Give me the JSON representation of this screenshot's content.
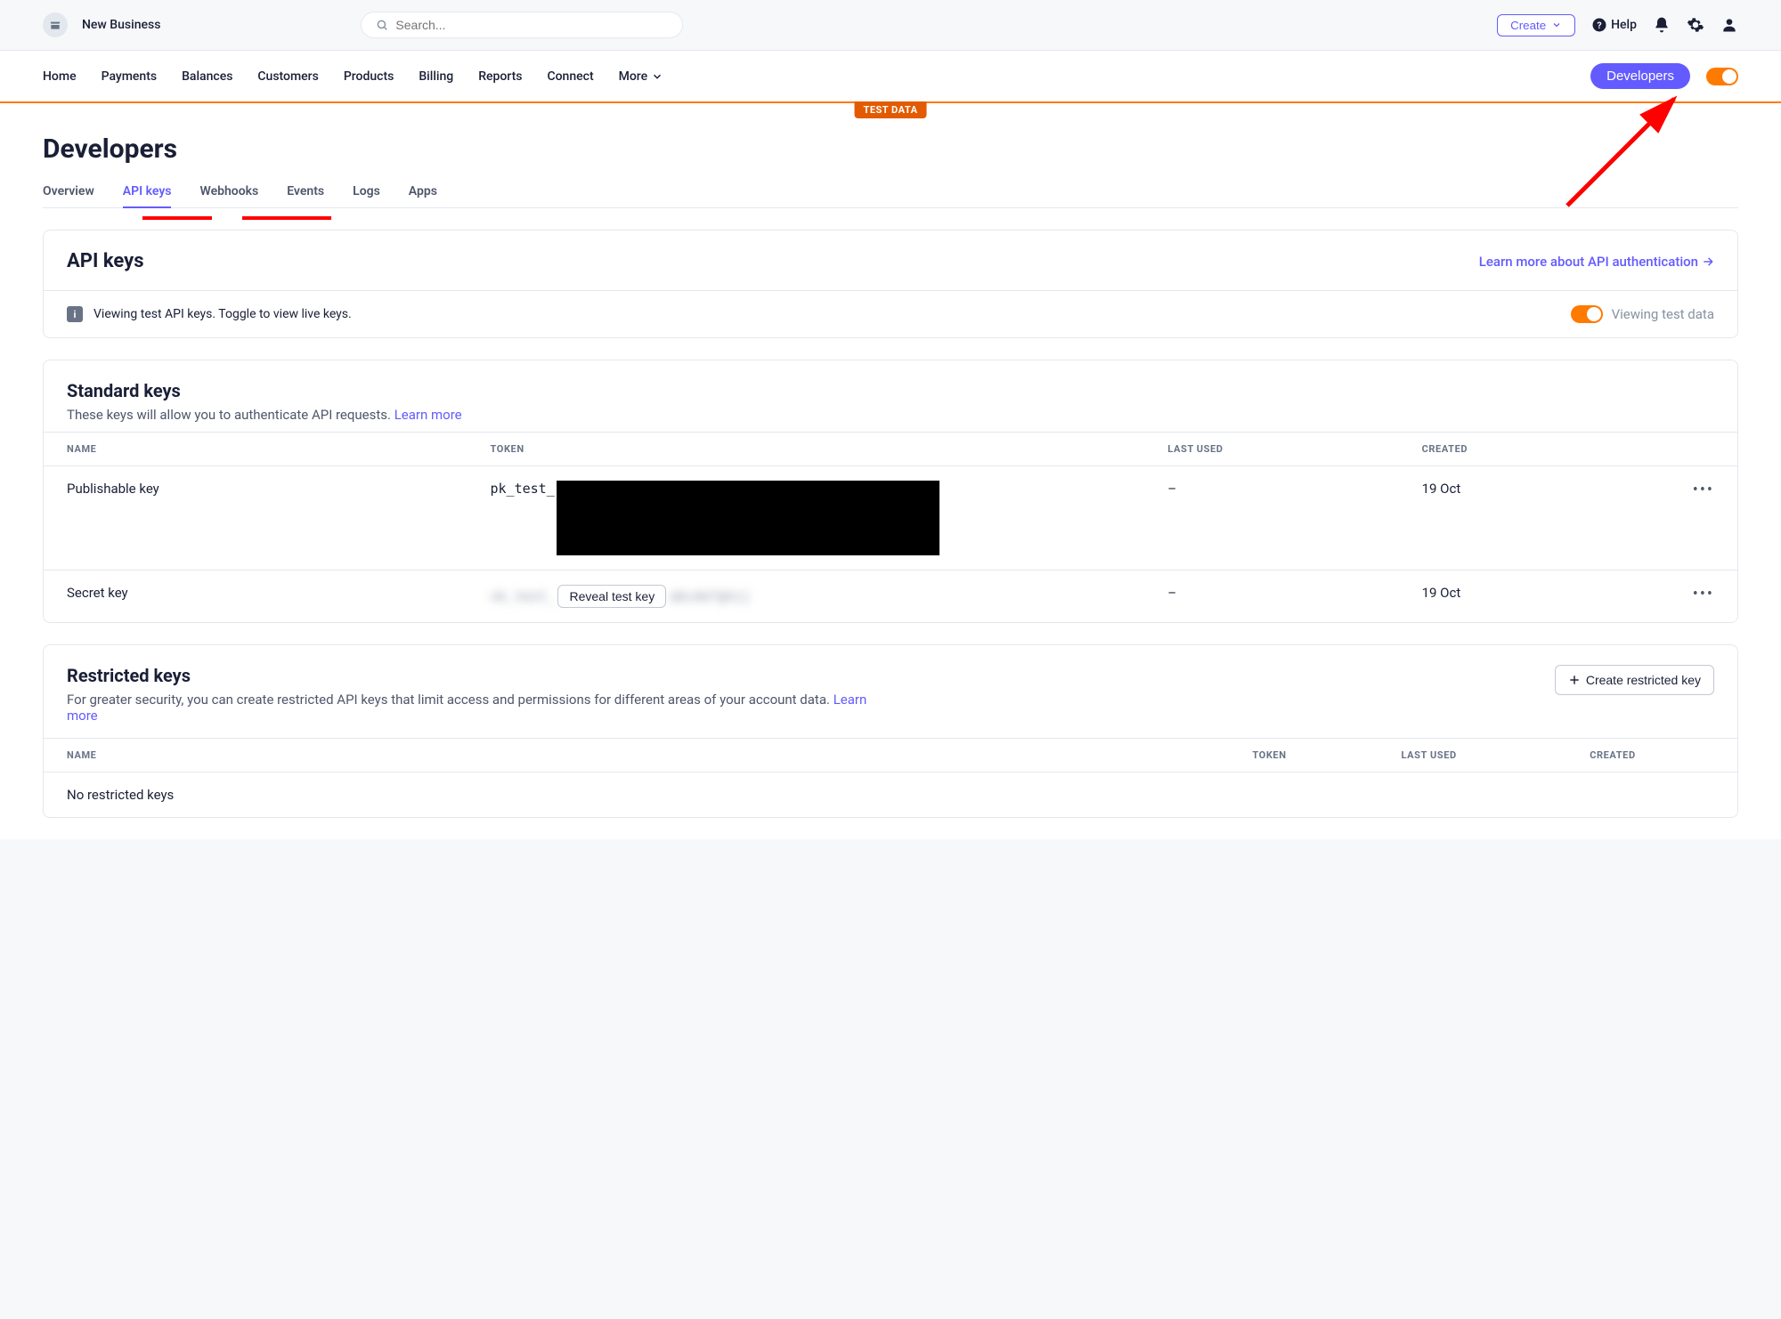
{
  "topbar": {
    "business_name": "New Business",
    "search_placeholder": "Search...",
    "create_label": "Create",
    "help_label": "Help"
  },
  "nav": {
    "items": [
      "Home",
      "Payments",
      "Balances",
      "Customers",
      "Products",
      "Billing",
      "Reports",
      "Connect"
    ],
    "more_label": "More",
    "developers_label": "Developers",
    "test_badge": "TEST DATA"
  },
  "page": {
    "title": "Developers"
  },
  "tabs": {
    "items": [
      "Overview",
      "API keys",
      "Webhooks",
      "Events",
      "Logs",
      "Apps"
    ],
    "active_index": 1
  },
  "apikeys_card": {
    "title": "API keys",
    "learn_more": "Learn more about API authentication",
    "info_text": "Viewing test API keys. Toggle to view live keys.",
    "toggle_label": "Viewing test data"
  },
  "standard_keys": {
    "title": "Standard keys",
    "description": "These keys will allow you to authenticate API requests.",
    "learn_more": "Learn more",
    "columns": [
      "NAME",
      "TOKEN",
      "LAST USED",
      "CREATED"
    ],
    "rows": [
      {
        "name": "Publishable key",
        "token_prefix": "pk_test_",
        "token_redacted": true,
        "last_used": "–",
        "created": "19 Oct"
      },
      {
        "name": "Secret key",
        "token_prefix": "",
        "reveal_label": "Reveal test key",
        "last_used": "–",
        "created": "19 Oct"
      }
    ]
  },
  "restricted_keys": {
    "title": "Restricted keys",
    "description": "For greater security, you can create restricted API keys that limit access and permissions for different areas of your account data.",
    "learn_more": "Learn more",
    "create_button": "Create restricted key",
    "columns": [
      "NAME",
      "TOKEN",
      "LAST USED",
      "CREATED"
    ],
    "empty_text": "No restricted keys"
  }
}
